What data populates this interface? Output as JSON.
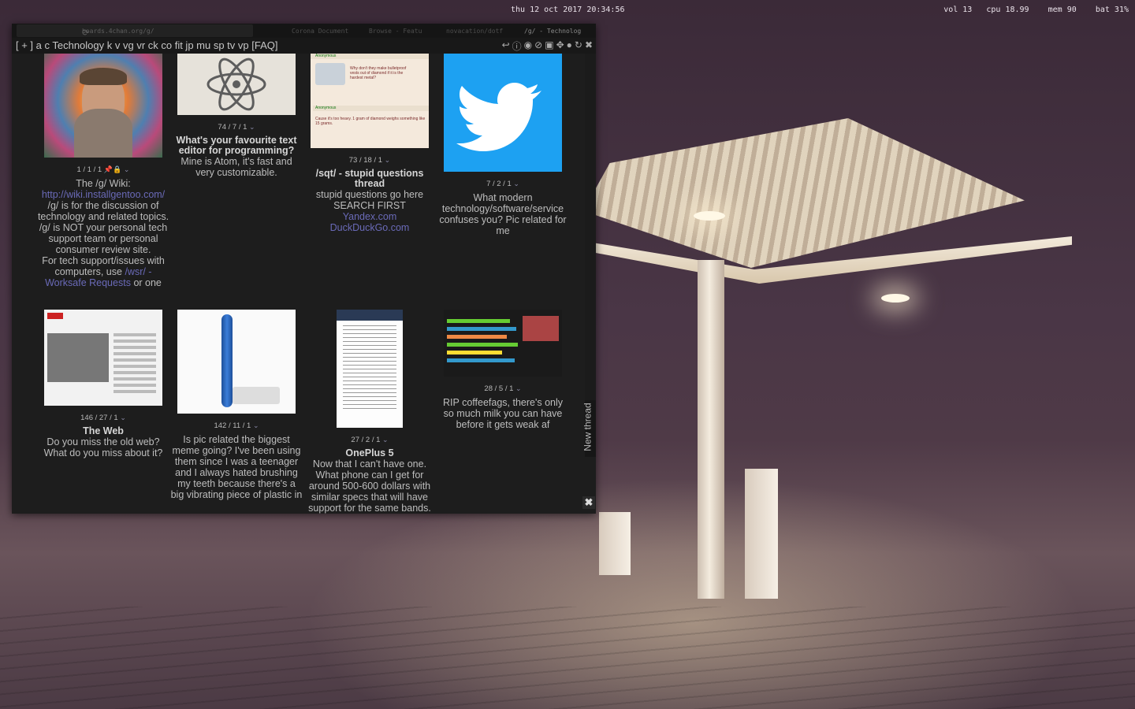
{
  "statusbar": {
    "clock": "thu 12 oct 2017 20:34:56",
    "system": "vol 13   cpu 18.99    mem 90    bat 31%"
  },
  "browser": {
    "url": "boards.4chan.org/g/",
    "tabs": [
      "Corona Document",
      "Browse - Featu",
      "novacation/dotf",
      "/g/ - Technolog"
    ],
    "navbar": "[ + ] a c Technology k v vg vr ck co fit jp mu sp tv vp [FAQ]",
    "new_thread": "New thread",
    "close": "✖"
  },
  "threads": [
    {
      "stats": "1 / 1 / 1",
      "chev": "⌄",
      "title": "",
      "body_pre": "The /g/ Wiki:",
      "link1": "http://wiki.installgentoo.com/",
      "body_mid": "/g/ is for the discussion of technology and related topics.",
      "body_mid2": "/g/ is NOT your personal tech support team or personal consumer review site.",
      "body_post": "For tech support/issues with computers, use",
      "link2": "/wsr/ - Worksafe Requests",
      "body_end": "or one"
    },
    {
      "stats": "74 / 7 / 1",
      "chev": "⌄",
      "title": "What's your favourite text editor for programming?",
      "body": "Mine is Atom, it's fast and very customizable."
    },
    {
      "stats": "73 / 18 / 1",
      "chev": "⌄",
      "title": "/sqt/ - stupid questions thread",
      "body": "stupid questions go here SEARCH FIRST",
      "link1": "Yandex.com",
      "link2": "DuckDuckGo.com",
      "thumb_text1": "Why don't they make bulletproof vests out of diamond if it is the hardest metal?",
      "thumb_text2": "Cause it's too heavy. 1 gram of diamond weighs something like 15 grams."
    },
    {
      "stats": "7 / 2 / 1",
      "chev": "⌄",
      "title": "",
      "body": "What modern technology/software/service confuses you? Pic related for me"
    },
    {
      "stats": "146 / 27 / 1",
      "chev": "⌄",
      "title": "The Web",
      "body": "Do you miss the old web? What do you miss about it?"
    },
    {
      "stats": "142 / 11 / 1",
      "chev": "⌄",
      "title": "",
      "body": "Is pic related the biggest meme going? I've been using them since I was a teenager and I always hated brushing my teeth because there's a big vibrating piece of plastic in"
    },
    {
      "stats": "27 / 2 / 1",
      "chev": "⌄",
      "title": "OnePlus 5",
      "body": "Now that I can't have one. What phone can I get for around 500-600 dollars with similar specs that will have support for the same bands."
    },
    {
      "stats": "28 / 5 / 1",
      "chev": "⌄",
      "title": "",
      "body": "RIP coffeefags, there's only so much milk you can have before it gets weak af"
    }
  ],
  "colors": {
    "link": "#6a6ab8",
    "twitter": "#1da1f2",
    "bg": "#1d1d1d"
  }
}
